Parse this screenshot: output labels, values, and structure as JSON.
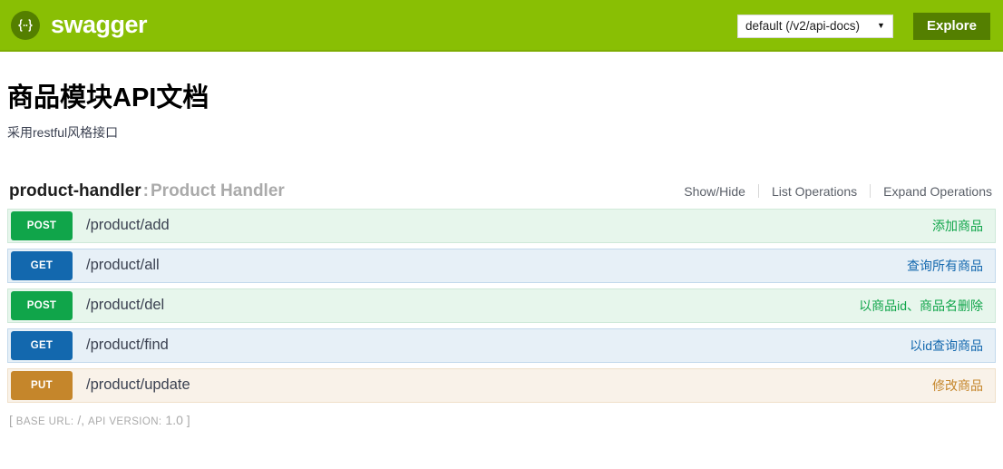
{
  "topbar": {
    "logo_icon": "swagger-braces-icon",
    "brand": "swagger",
    "api_select_value": "default (/v2/api-docs)",
    "api_select_caret": "▼",
    "explore_label": "Explore",
    "bar_color": "#89bf04",
    "explore_color": "#547f00"
  },
  "info": {
    "title": "商品模块API文档",
    "description": "采用restful风格接口"
  },
  "resource": {
    "id": "product-handler",
    "separator": ":",
    "description": "Product Handler",
    "options": [
      {
        "label": "Show/Hide"
      },
      {
        "label": "List Operations"
      },
      {
        "label": "Expand Operations"
      }
    ],
    "operations": [
      {
        "method": "POST",
        "method_class": "post",
        "path": "/product/add",
        "summary": "添加商品",
        "color": "#10a54a"
      },
      {
        "method": "GET",
        "method_class": "get",
        "path": "/product/all",
        "summary": "查询所有商品",
        "color": "#1368ae"
      },
      {
        "method": "POST",
        "method_class": "post",
        "path": "/product/del",
        "summary": "以商品id、商品名删除",
        "color": "#10a54a"
      },
      {
        "method": "GET",
        "method_class": "get",
        "path": "/product/find",
        "summary": "以id查询商品",
        "color": "#1368ae"
      },
      {
        "method": "PUT",
        "method_class": "put",
        "path": "/product/update",
        "summary": "修改商品",
        "color": "#c5862b"
      }
    ]
  },
  "footer": {
    "open_bracket": "[",
    "base_url_label": "BASE URL:",
    "base_url_value": "/",
    "comma": ",",
    "api_version_label": "API VERSION:",
    "api_version_value": "1.0",
    "close_bracket": "]"
  }
}
